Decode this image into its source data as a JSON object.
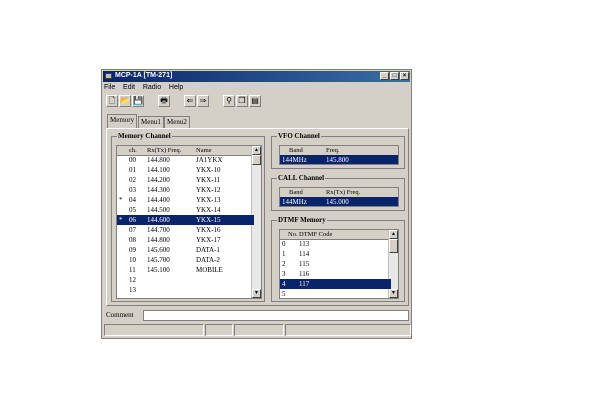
{
  "window": {
    "title": "MCP-1A [TM-271]"
  },
  "menu": [
    "File",
    "Edit",
    "Radio",
    "Help"
  ],
  "toolbar": [
    {
      "icon": "new-file-icon",
      "glyph": "🗋"
    },
    {
      "icon": "open-folder-icon",
      "glyph": "📂"
    },
    {
      "icon": "save-icon",
      "glyph": "💾"
    },
    {
      "icon": "print-icon",
      "glyph": "🖶"
    },
    {
      "icon": "read-radio-icon",
      "glyph": "⇐"
    },
    {
      "icon": "write-radio-icon",
      "glyph": "⇒"
    },
    {
      "icon": "find-icon",
      "glyph": "⚲"
    },
    {
      "icon": "copy-icon",
      "glyph": "❐"
    },
    {
      "icon": "paste-icon",
      "glyph": "▤"
    }
  ],
  "tabs": [
    "Memory",
    "Menu1",
    "Menu2"
  ],
  "memory": {
    "label": "Memory Channel",
    "headers": [
      "ch.",
      "Rx(Tx) Freq.",
      "Name"
    ],
    "rows": [
      {
        "mark": "",
        "ch": "00",
        "freq": "144.800",
        "name": "JA1YKX"
      },
      {
        "mark": "",
        "ch": "01",
        "freq": "144.100",
        "name": "YKX-10"
      },
      {
        "mark": "",
        "ch": "02",
        "freq": "144.200",
        "name": "YKX-11"
      },
      {
        "mark": "",
        "ch": "03",
        "freq": "144.300",
        "name": "YKX-12"
      },
      {
        "mark": "*",
        "ch": "04",
        "freq": "144.400",
        "name": "YKX-13"
      },
      {
        "mark": "",
        "ch": "05",
        "freq": "144.500",
        "name": "YKX-14"
      },
      {
        "mark": "*",
        "ch": "06",
        "freq": "144.600",
        "name": "YKX-15"
      },
      {
        "mark": "",
        "ch": "07",
        "freq": "144.700",
        "name": "YKX-16"
      },
      {
        "mark": "",
        "ch": "08",
        "freq": "144.800",
        "name": "YKX-17"
      },
      {
        "mark": "",
        "ch": "09",
        "freq": "145.600",
        "name": "DATA-1"
      },
      {
        "mark": "",
        "ch": "10",
        "freq": "145.700",
        "name": "DATA-2"
      },
      {
        "mark": "",
        "ch": "11",
        "freq": "145.100",
        "name": "MOBILE"
      },
      {
        "mark": "",
        "ch": "12",
        "freq": "",
        "name": ""
      },
      {
        "mark": "",
        "ch": "13",
        "freq": "",
        "name": ""
      }
    ],
    "selected_row": 6
  },
  "vfo": {
    "label": "VFO Channel",
    "headers": [
      "Band",
      "Freq."
    ],
    "row": {
      "band": "144MHz",
      "freq": "145.800"
    }
  },
  "call": {
    "label": "CALL Channel",
    "headers": [
      "Band",
      "Rx(Tx) Freq."
    ],
    "row": {
      "band": "144MHz",
      "freq": "145.000"
    }
  },
  "dtmf": {
    "label": "DTMF Memory",
    "headers": [
      "No.",
      "DTMF Code"
    ],
    "rows": [
      {
        "no": "0",
        "code": "113"
      },
      {
        "no": "1",
        "code": "114"
      },
      {
        "no": "2",
        "code": "115"
      },
      {
        "no": "3",
        "code": "116"
      },
      {
        "no": "4",
        "code": "117"
      },
      {
        "no": "5",
        "code": ""
      }
    ],
    "selected_row": 4
  },
  "comment": {
    "label": "Comment",
    "value": ""
  }
}
